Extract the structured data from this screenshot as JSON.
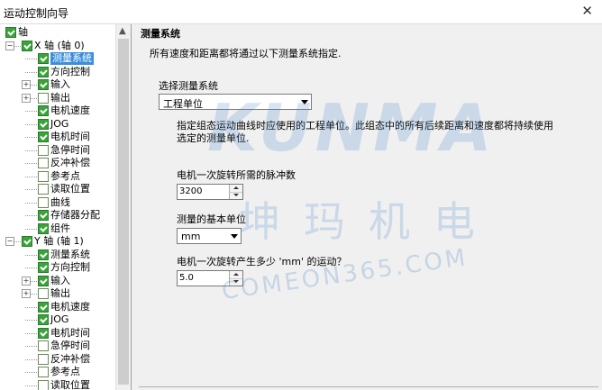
{
  "window": {
    "title": "运动控制向导",
    "close_glyph": "✕"
  },
  "tree": {
    "root": "轴",
    "axis0": {
      "label": "X 轴 (轴 0)",
      "items": [
        "测量系统",
        "方向控制",
        "输入",
        "输出",
        "电机速度",
        "JOG",
        "电机时间",
        "急停时间",
        "反冲补偿",
        "参考点",
        "读取位置",
        "曲线",
        "存储器分配",
        "组件"
      ]
    },
    "axis1": {
      "label": "Y 轴 (轴 1)",
      "items": [
        "测量系统",
        "方向控制",
        "输入",
        "输出",
        "电机速度",
        "JOG",
        "电机时间",
        "急停时间",
        "反冲补偿",
        "参考点",
        "读取位置"
      ]
    }
  },
  "content": {
    "section_title": "测量系统",
    "section_desc": "所有速度和距离都将通过以下测量系统指定.",
    "system_label": "选择测量系统",
    "system_value": "工程单位",
    "note": "指定组态运动曲线时应使用的工程单位。此组态中的所有后续距离和速度都将持续使用选定的测量单位.",
    "pulses_label": "电机一次旋转所需的脉冲数",
    "pulses_value": "3200",
    "unit_label": "测量的基本单位",
    "unit_value": "mm",
    "motion_label": "电机一次旋转产生多少 'mm' 的运动？",
    "motion_value": "5.0"
  },
  "watermark": {
    "main": "KUNMA",
    "cn": "坤玛机电",
    "en": "COMEON365.COM"
  }
}
